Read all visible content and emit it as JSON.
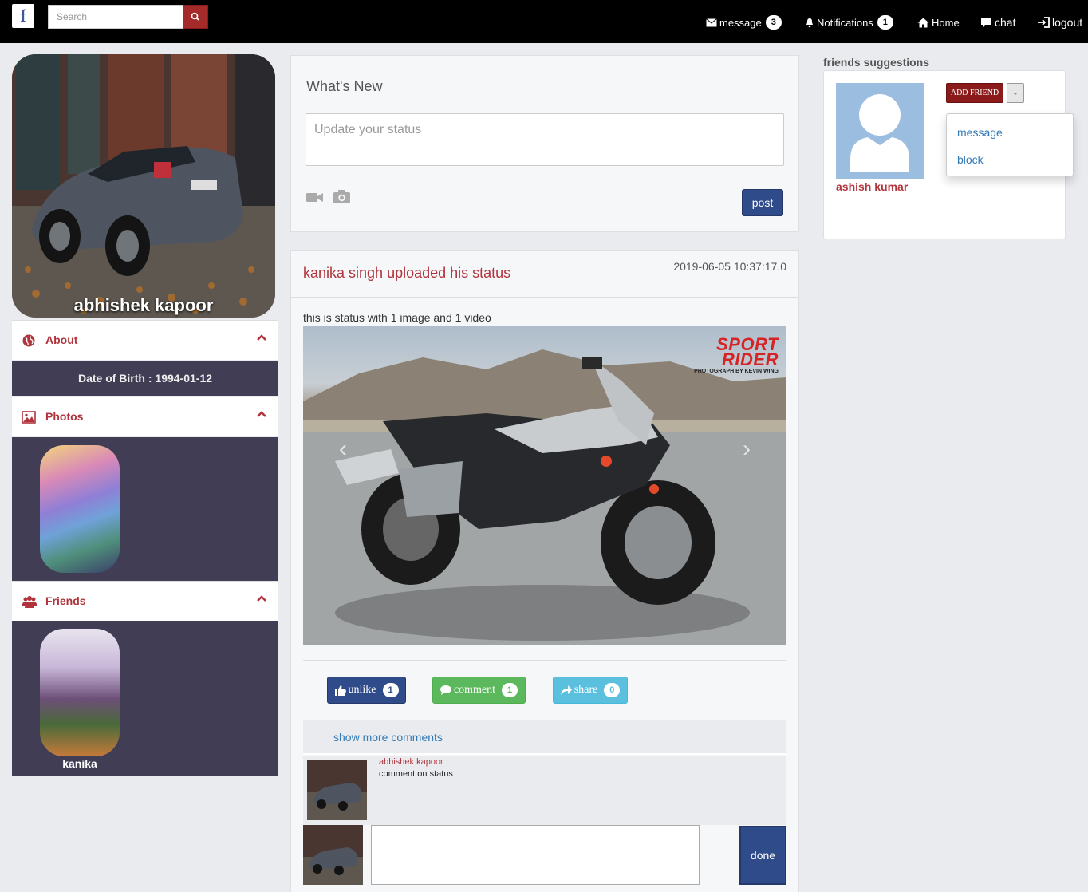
{
  "navbar": {
    "logo": "f",
    "search_placeholder": "Search",
    "message_label": "message",
    "message_count": "3",
    "notifications_label": "Notifications",
    "notifications_count": "1",
    "home_label": "Home",
    "chat_label": "chat",
    "logout_label": "logout"
  },
  "profile": {
    "name": "abhishek kapoor",
    "about_label": "About",
    "dob_text": "Date of Birth : 1994-01-12",
    "photos_label": "Photos",
    "friends_label": "Friends",
    "friends": [
      {
        "name": "kanika"
      }
    ]
  },
  "composer": {
    "heading": "What's New",
    "placeholder": "Update your status",
    "post_label": "post"
  },
  "post": {
    "title": "kanika singh uploaded his status",
    "timestamp": "2019-06-05 10:37:17.0",
    "text": "this is status with 1 image and 1 video",
    "image_brand_line1": "SPORT",
    "image_brand_line2": "RIDER",
    "image_credit": "PHOTOGRAPH BY KEVIN WING",
    "unlike_label": "unlike",
    "unlike_count": "1",
    "comment_label": "comment",
    "comment_count": "1",
    "share_label": "share",
    "share_count": "0",
    "show_more_label": "show more comments",
    "comments": [
      {
        "author": "abhishek kapoor",
        "text": "comment on status"
      }
    ],
    "done_label": "done"
  },
  "suggestions": {
    "title": "friends suggestions",
    "name": "ashish kumar",
    "add_friend_label": "ADD FRIEND",
    "menu": [
      "message",
      "block"
    ]
  },
  "colors": {
    "navbar": "#000000",
    "accent_red": "#b0343c",
    "panel_dark": "#403d55",
    "primary_blue": "#2f4b8a",
    "like_blue": "#2f4b8a",
    "comment_green": "#5cb85c",
    "share_cyan": "#5bc0de"
  }
}
